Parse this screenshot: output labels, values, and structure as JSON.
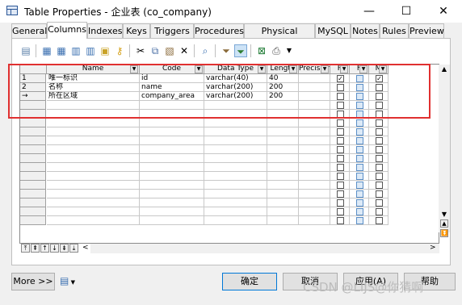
{
  "window": {
    "title": "Table Properties - 企业表 (co_company)",
    "minimize": "—",
    "maximize": "☐",
    "close": "✕"
  },
  "tabs": [
    {
      "label": "General"
    },
    {
      "label": "Columns"
    },
    {
      "label": "Indexes"
    },
    {
      "label": "Keys"
    },
    {
      "label": "Triggers"
    },
    {
      "label": "Procedures"
    },
    {
      "label": "Physical Options"
    },
    {
      "label": "MySQL"
    },
    {
      "label": "Notes"
    },
    {
      "label": "Rules"
    },
    {
      "label": "Preview"
    }
  ],
  "active_tab": "Columns",
  "grid": {
    "headers": [
      "Name",
      "Code",
      "Data Type",
      "Length",
      "Precision",
      "P",
      "F",
      "M"
    ],
    "rows": [
      {
        "num": "1",
        "name": "唯一标识",
        "code": "id",
        "type": "varchar(40)",
        "length": "40",
        "p": true,
        "f": false,
        "m": true
      },
      {
        "num": "2",
        "name": "名称",
        "code": "name",
        "type": "varchar(200)",
        "length": "200",
        "p": false,
        "f": false,
        "m": false
      },
      {
        "num": "→",
        "name": "所在区域",
        "code": "company_area",
        "type": "varchar(200)",
        "length": "200",
        "p": false,
        "f": false,
        "m": false
      }
    ],
    "empty_rows": 14
  },
  "buttons": {
    "more": "More >>",
    "ok": "确定",
    "cancel": "取消",
    "apply": "应用(A)",
    "help": "帮助"
  },
  "watermark": "CSDN @LIJS@你猜啊"
}
